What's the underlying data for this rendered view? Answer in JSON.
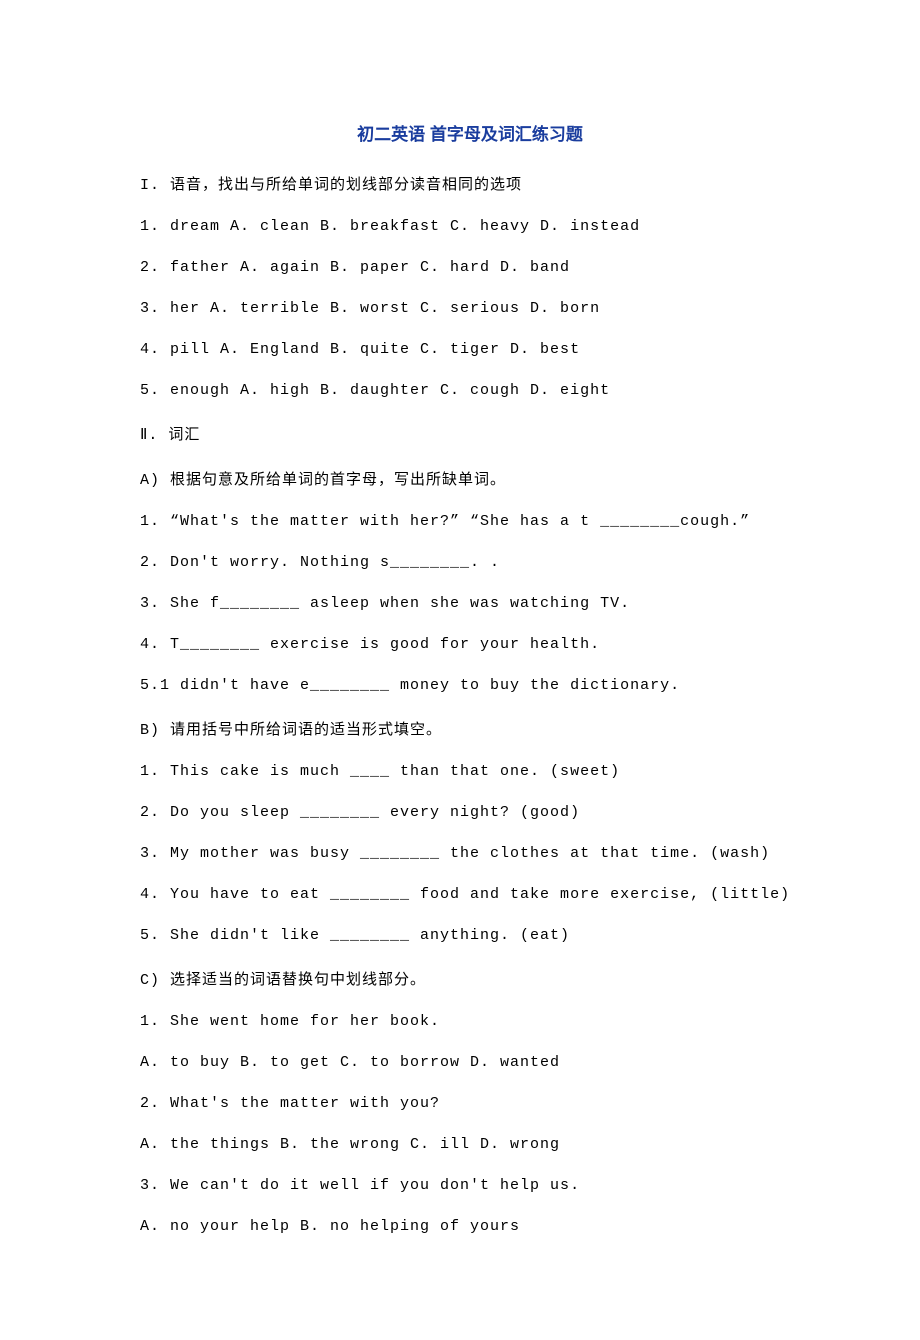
{
  "title": "初二英语 首字母及词汇练习题",
  "lines": [
    "I. 语音，找出与所给单词的划线部分读音相同的选项",
    "1. dream A. clean B. breakfast C. heavy D. instead",
    "2. father A. again B. paper C. hard D. band",
    "3. her A. terrible B. worst C. serious D. born",
    "4. pill A. England B. quite C. tiger D. best",
    "5. enough A. high B. daughter C. cough D. eight",
    "Ⅱ.  词汇",
    "A) 根据句意及所给单词的首字母，写出所缺单词。",
    "1. “What's the matter with her?” “She has a t ________cough.”",
    "2. Don't worry. Nothing s________. .",
    "3. She f________ asleep when she was watching TV.",
    "4. T________ exercise is good for your health.",
    "5.1 didn't have e________ money to buy the dictionary.",
    "B) 请用括号中所给词语的适当形式填空。",
    "1. This cake is much ____ than that one. (sweet)",
    "2. Do you sleep ________ every night? (good)",
    "3. My mother was busy ________ the clothes at that time. (wash)",
    "4. You have to eat ________ food and take more exercise, (little)",
    "5. She didn't like ________ anything. (eat)",
    "C) 选择适当的词语替换句中划线部分。",
    "1. She went home for her book.",
    "A. to buy B. to get C. to borrow D. wanted",
    "2. What's the matter with you?",
    "A. the things B. the wrong C. ill D. wrong",
    "3. We can't do it well if you don't help us.",
    "A. no your help B. no helping of yours"
  ]
}
